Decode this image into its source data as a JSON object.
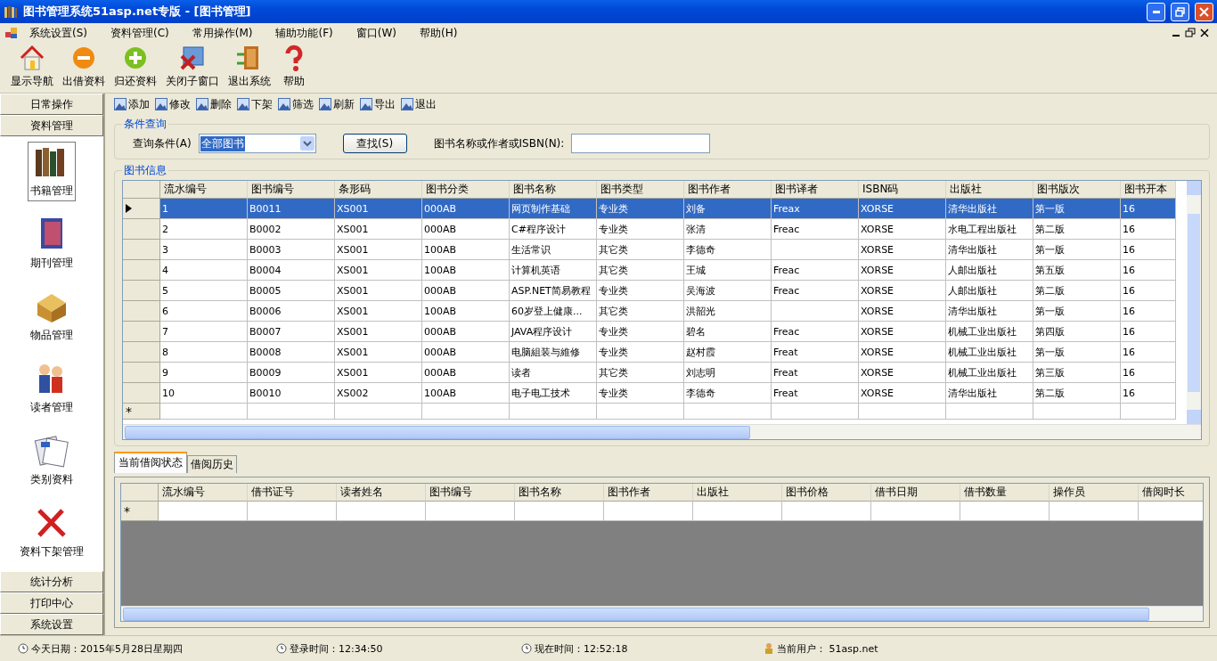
{
  "window": {
    "title": "图书管理系统51asp.net专版 - [图书管理]"
  },
  "menu": [
    {
      "label": "系统设置(S)"
    },
    {
      "label": "资料管理(C)"
    },
    {
      "label": "常用操作(M)"
    },
    {
      "label": "辅助功能(F)"
    },
    {
      "label": "窗口(W)"
    },
    {
      "label": "帮助(H)"
    }
  ],
  "toolbar": [
    {
      "label": "显示导航"
    },
    {
      "label": "出借资料"
    },
    {
      "label": "归还资料"
    },
    {
      "label": "关闭子窗口"
    },
    {
      "label": "退出系统"
    },
    {
      "label": "帮助"
    }
  ],
  "sidebar": {
    "top": [
      {
        "label": "日常操作"
      },
      {
        "label": "资料管理"
      }
    ],
    "items": [
      {
        "label": "书籍管理",
        "selected": true
      },
      {
        "label": "期刊管理",
        "selected": false
      },
      {
        "label": "物品管理",
        "selected": false
      },
      {
        "label": "读者管理",
        "selected": false
      },
      {
        "label": "类别资料",
        "selected": false
      },
      {
        "label": "资料下架管理",
        "selected": false
      }
    ],
    "bottom": [
      {
        "label": "统计分析"
      },
      {
        "label": "打印中心"
      },
      {
        "label": "系统设置"
      }
    ]
  },
  "actions": [
    "添加",
    "修改",
    "删除",
    "下架",
    "筛选",
    "刷新",
    "导出",
    "退出"
  ],
  "query": {
    "title": "条件查询",
    "condition_label": "查询条件(A)",
    "condition_value": "全部图书",
    "search_button": "查找(S)",
    "keyword_label": "图书名称或作者或ISBN(N):"
  },
  "books": {
    "title": "图书信息",
    "new_row_marker": "*",
    "columns": [
      "流水编号",
      "图书编号",
      "条形码",
      "图书分类",
      "图书名称",
      "图书类型",
      "图书作者",
      "图书译者",
      "ISBN码",
      "出版社",
      "图书版次",
      "图书开本"
    ],
    "rows": [
      {
        "selected": true,
        "cells": [
          "1",
          "B0011",
          "XS001",
          "000AB",
          "网页制作基础",
          "专业类",
          "刘备",
          "Freax",
          "XORSE",
          "清华出版社",
          "第一版",
          "16"
        ]
      },
      {
        "selected": false,
        "cells": [
          "2",
          "B0002",
          "XS001",
          "000AB",
          "C#程序设计",
          "专业类",
          "张清",
          "Freac",
          "XORSE",
          "水电工程出版社",
          "第二版",
          "16"
        ]
      },
      {
        "selected": false,
        "cells": [
          "3",
          "B0003",
          "XS001",
          "100AB",
          "生活常识",
          "其它类",
          "李德奇",
          "",
          "XORSE",
          "清华出版社",
          "第一版",
          "16"
        ]
      },
      {
        "selected": false,
        "cells": [
          "4",
          "B0004",
          "XS001",
          "100AB",
          "计算机英语",
          "其它类",
          "王城",
          "Freac",
          "XORSE",
          "人邮出版社",
          "第五版",
          "16"
        ]
      },
      {
        "selected": false,
        "cells": [
          "5",
          "B0005",
          "XS001",
          "000AB",
          "ASP.NET简易教程",
          "专业类",
          "吴海波",
          "Freac",
          "XORSE",
          "人邮出版社",
          "第二版",
          "16"
        ]
      },
      {
        "selected": false,
        "cells": [
          "6",
          "B0006",
          "XS001",
          "100AB",
          "60岁登上健康...",
          "其它类",
          "洪韶光",
          "",
          "XORSE",
          "清华出版社",
          "第一版",
          "16"
        ]
      },
      {
        "selected": false,
        "cells": [
          "7",
          "B0007",
          "XS001",
          "000AB",
          "JAVA程序设计",
          "专业类",
          "碧名",
          "Freac",
          "XORSE",
          "机械工业出版社",
          "第四版",
          "16"
        ]
      },
      {
        "selected": false,
        "cells": [
          "8",
          "B0008",
          "XS001",
          "000AB",
          "电脑組装与維修",
          "专业类",
          "赵村霞",
          "Freat",
          "XORSE",
          "机械工业出版社",
          "第一版",
          "16"
        ]
      },
      {
        "selected": false,
        "cells": [
          "9",
          "B0009",
          "XS001",
          "000AB",
          "读者",
          "其它类",
          "刘志明",
          "Freat",
          "XORSE",
          "机械工业出版社",
          "第三版",
          "16"
        ]
      },
      {
        "selected": false,
        "cells": [
          "10",
          "B0010",
          "XS002",
          "100AB",
          "电子电工技术",
          "专业类",
          "李德奇",
          "Freat",
          "XORSE",
          "清华出版社",
          "第二版",
          "16"
        ]
      }
    ]
  },
  "borrow_tabs": [
    {
      "label": "当前借阅状态",
      "selected": true
    },
    {
      "label": "借阅历史",
      "selected": false
    }
  ],
  "borrow": {
    "new_row_marker": "*",
    "columns": [
      "流水编号",
      "借书证号",
      "读者姓名",
      "图书编号",
      "图书名称",
      "图书作者",
      "出版社",
      "图书价格",
      "借书日期",
      "借书数量",
      "操作员",
      "借阅时长"
    ]
  },
  "status_bar": [
    "今天日期：2015年5月28日星期四",
    "登录时间：12:34:50",
    "现在时间：12:52:18",
    "当前用户： 51asp.net"
  ]
}
